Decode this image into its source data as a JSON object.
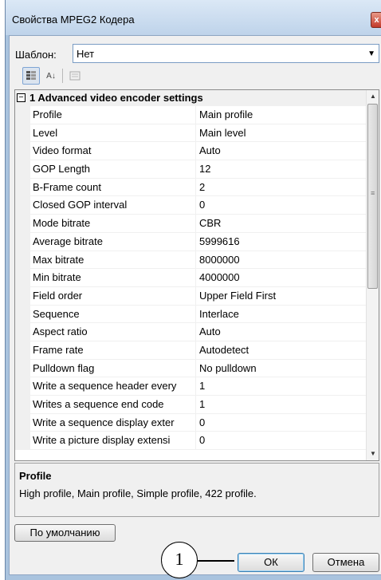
{
  "window": {
    "title": "Свойства MPEG2 Кодера",
    "close_glyph": "x"
  },
  "template": {
    "label": "Шаблон:",
    "value": "Нет"
  },
  "toolbar": {
    "icons": [
      "categorized-view-icon",
      "alphabetical-sort-icon",
      "property-pages-icon"
    ],
    "sort_glyph": "A↓"
  },
  "grid": {
    "category": {
      "label": "1 Advanced video encoder settings",
      "toggle": "−"
    },
    "rows": [
      {
        "name": "Profile",
        "value": "Main profile"
      },
      {
        "name": "Level",
        "value": "Main level"
      },
      {
        "name": "Video format",
        "value": "Auto"
      },
      {
        "name": "GOP Length",
        "value": "12"
      },
      {
        "name": "B-Frame count",
        "value": "2"
      },
      {
        "name": "Closed GOP interval",
        "value": "0"
      },
      {
        "name": "Mode bitrate",
        "value": "CBR"
      },
      {
        "name": "Average bitrate",
        "value": "5999616"
      },
      {
        "name": "Max bitrate",
        "value": "8000000"
      },
      {
        "name": "Min bitrate",
        "value": "4000000"
      },
      {
        "name": "Field order",
        "value": "Upper Field First"
      },
      {
        "name": "Sequence",
        "value": "Interlace"
      },
      {
        "name": "Aspect ratio",
        "value": "Auto"
      },
      {
        "name": "Frame rate",
        "value": "Autodetect"
      },
      {
        "name": "Pulldown flag",
        "value": "No pulldown"
      },
      {
        "name": "Write a sequence header every",
        "value": "1"
      },
      {
        "name": "Writes a sequence end code",
        "value": "1"
      },
      {
        "name": "Write a sequence display exter",
        "value": "0"
      },
      {
        "name": "Write a picture display extensi",
        "value": "0"
      }
    ]
  },
  "description": {
    "title": "Profile",
    "text": "High profile, Main profile, Simple profile, 422 profile."
  },
  "buttons": {
    "default": "По умолчанию",
    "ok": "ОК",
    "cancel": "Отмена"
  },
  "callout": {
    "number": "1"
  }
}
